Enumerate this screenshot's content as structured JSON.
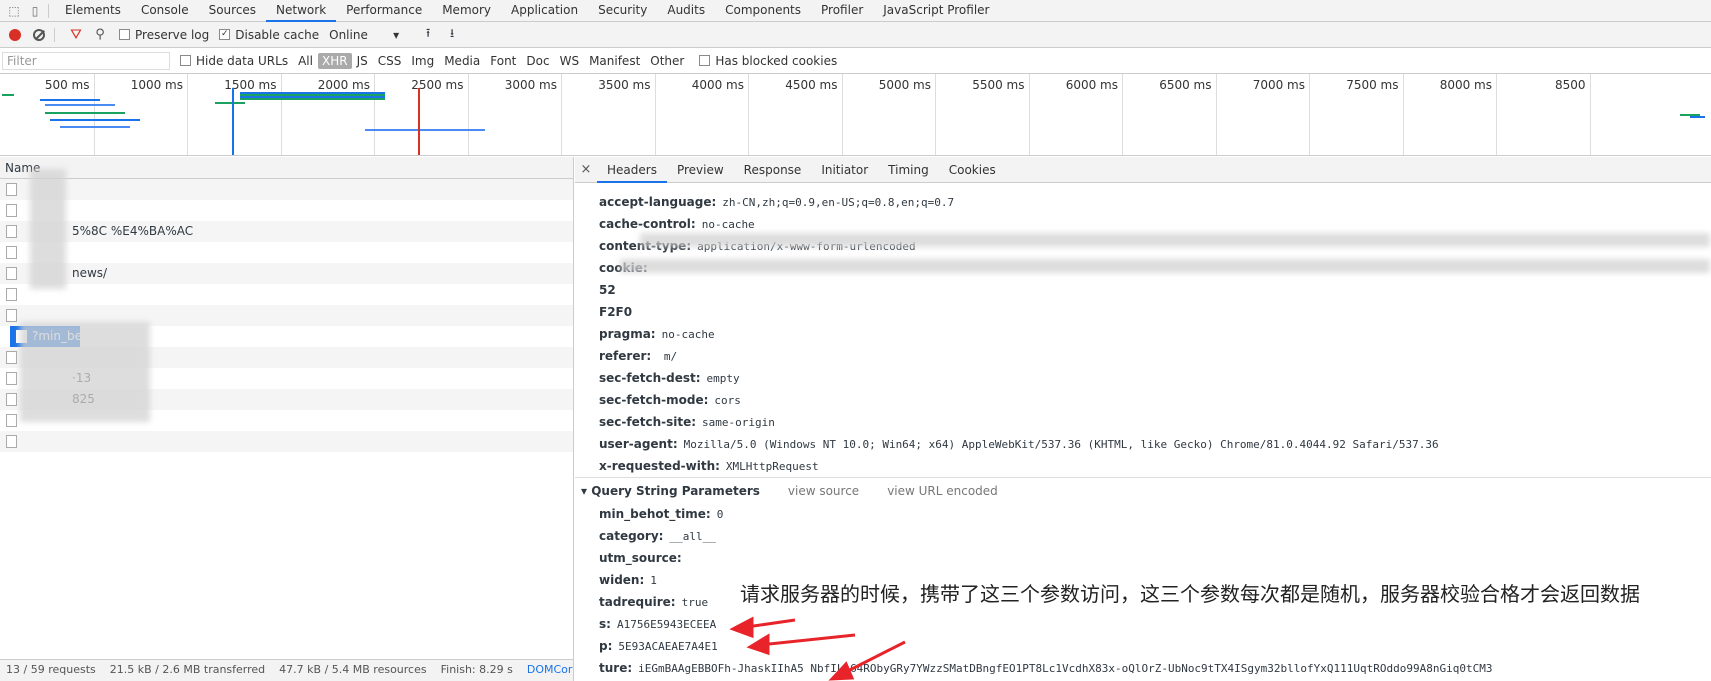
{
  "devtools_tabs": [
    "Elements",
    "Console",
    "Sources",
    "Network",
    "Performance",
    "Memory",
    "Application",
    "Security",
    "Audits",
    "Components",
    "Profiler",
    "JavaScript Profiler"
  ],
  "active_tab": "Network",
  "toolbar": {
    "preserve_log": "Preserve log",
    "disable_cache": "Disable cache",
    "throttle": "Online"
  },
  "filterbar": {
    "placeholder": "Filter",
    "hide_data_urls": "Hide data URLs",
    "types": [
      "All",
      "XHR",
      "JS",
      "CSS",
      "Img",
      "Media",
      "Font",
      "Doc",
      "WS",
      "Manifest",
      "Other"
    ],
    "active_type": "XHR",
    "blocked": "Has blocked cookies"
  },
  "timeline": {
    "ticks": [
      "500 ms",
      "1000 ms",
      "1500 ms",
      "2000 ms",
      "2500 ms",
      "3000 ms",
      "3500 ms",
      "4000 ms",
      "4500 ms",
      "5000 ms",
      "5500 ms",
      "6000 ms",
      "6500 ms",
      "7000 ms",
      "7500 ms",
      "8000 ms",
      "8500"
    ]
  },
  "list": {
    "header": "Name",
    "rows": [
      "",
      "",
      "5%8C   %E4%BA%AC",
      "",
      "news/",
      "",
      "",
      "?min_behot_time=0&category=__all__&utm_source=tout...UbNoc9tTX4ISgym32bllofYxQ1I1UqtROdd...",
      "",
      "·13",
      "825",
      "",
      ""
    ],
    "selected_index": 7,
    "status": [
      "13 / 59 requests",
      "21.5 kB / 2.6 MB transferred",
      "47.7 kB / 5.4 MB resources",
      "Finish: 8.29 s",
      "DOMCor"
    ]
  },
  "detail": {
    "tabs": [
      "Headers",
      "Preview",
      "Response",
      "Initiator",
      "Timing",
      "Cookies"
    ],
    "active": "Headers",
    "headers": [
      {
        "k": "accept-language:",
        "v": "zh-CN,zh;q=0.9,en-US;q=0.8,en;q=0.7"
      },
      {
        "k": "cache-control:",
        "v": "no-cache"
      },
      {
        "k": "content-type:",
        "v": "application/x-www-form-urlencoded"
      },
      {
        "k": "cookie:",
        "v": ""
      },
      {
        "k": "52",
        "v": ""
      },
      {
        "k": "F2F0",
        "v": ""
      },
      {
        "k": "pragma:",
        "v": "no-cache"
      },
      {
        "k": "referer:",
        "v": "                    m/"
      },
      {
        "k": "sec-fetch-dest:",
        "v": "empty"
      },
      {
        "k": "sec-fetch-mode:",
        "v": "cors"
      },
      {
        "k": "sec-fetch-site:",
        "v": "same-origin"
      },
      {
        "k": "user-agent:",
        "v": "Mozilla/5.0 (Windows NT 10.0; Win64; x64) AppleWebKit/537.36 (KHTML, like Gecko) Chrome/81.0.4044.92 Safari/537.36"
      },
      {
        "k": "x-requested-with:",
        "v": "XMLHttpRequest"
      }
    ],
    "qs_title": "Query String Parameters",
    "view_source": "view source",
    "view_url": "view URL encoded",
    "params": [
      {
        "k": "min_behot_time:",
        "v": "0"
      },
      {
        "k": "category:",
        "v": "__all__"
      },
      {
        "k": "utm_source:",
        "v": ""
      },
      {
        "k": "widen:",
        "v": "1"
      },
      {
        "k": "tadrequire:",
        "v": "true"
      },
      {
        "k": "s:",
        "v": "A1756E5943ECEEA"
      },
      {
        "k": "p:",
        "v": "5E93ACAEAE7A4E1"
      },
      {
        "k": "ture:",
        "v": "iEGmBAAgEBBOFh-JhaskIIhA5    NbfILs64RObyGRy7YWzzSMatDBngfEO1PT8Lc1VcdhX83x-oQlOrZ-UbNoc9tTX4ISgym32bllofYxQ111UqtROddo99A8nGiq0tCM3"
      }
    ]
  },
  "annotation": "请求服务器的时候，携带了这三个参数访问，这三个参数每次都是随机，服务器校验合格才会返回数据",
  "colors": {
    "accent": "#1a73e8",
    "arrow": "#e8242a"
  }
}
